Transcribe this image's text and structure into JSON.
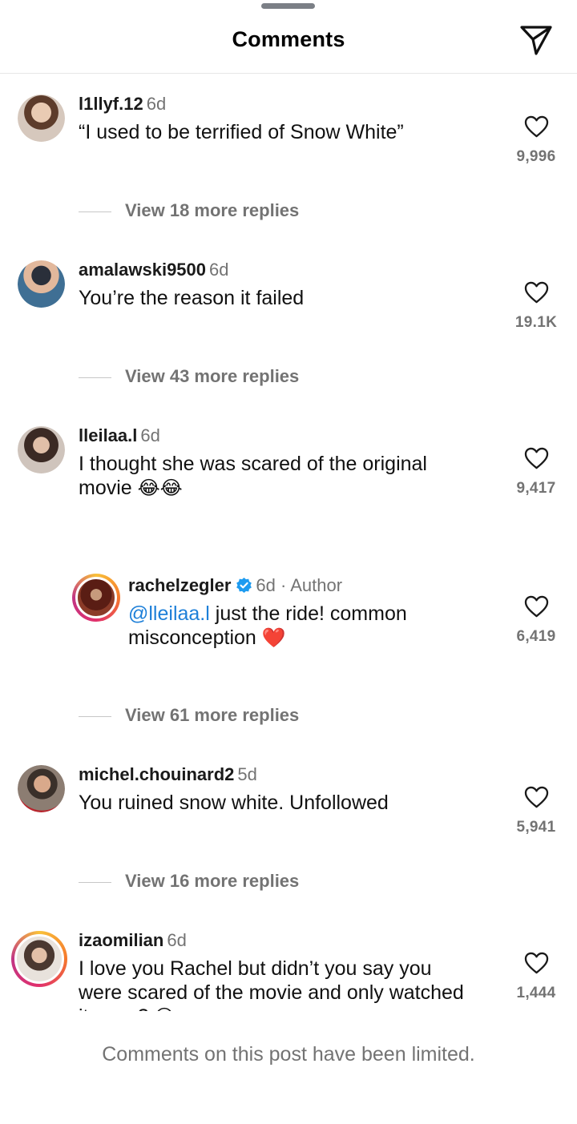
{
  "header": {
    "title": "Comments"
  },
  "comments": [
    {
      "username": "l1llyf.12",
      "time": "6d",
      "text": "“I used to be terrified of Snow White”",
      "likes": "9,996",
      "avatar_color": "#c9a78f",
      "replies_label": "View 18 more replies"
    },
    {
      "username": "amalawski9500",
      "time": "6d",
      "text": "You’re the reason it failed",
      "likes": "19.1K",
      "avatar_color": "#4a7fa8",
      "replies_label": "View 43 more replies"
    },
    {
      "username": "lleilaa.l",
      "time": "6d",
      "text": "I thought she was scared of the original movie",
      "emoji": "😂😂",
      "likes": "9,417",
      "avatar_color": "#8a7468"
    },
    {
      "username": "rachelzegler",
      "time": "6d",
      "author_label": "· Author",
      "mention": "@lleilaa.l",
      "text": " just the ride! common misconception",
      "emoji": "❤️",
      "likes": "6,419",
      "avatar_color": "#7a2a1e",
      "replies_label": "View 61 more replies"
    },
    {
      "username": "michel.chouinard2",
      "time": "5d",
      "text": "You ruined snow white. Unfollowed",
      "likes": "5,941",
      "avatar_color": "#6b5a4e",
      "replies_label": "View 16 more replies"
    },
    {
      "username": "izaomilian",
      "time": "6d",
      "text": "I love you Rachel but didn’t you say you were scared of the movie and only watched it once?",
      "emoji": "😅",
      "likes": "1,444",
      "avatar_color": "#b8a49a"
    }
  ],
  "footer": {
    "text": "Comments on this post have been limited."
  },
  "colors": {
    "accent": "#1d7fd8",
    "muted": "#737373",
    "verified": "#1d9bf0",
    "heart_red": "#e8262f"
  },
  "icons": {
    "share": "paper-plane-icon",
    "like": "heart-outline-icon",
    "verified": "verified-badge-icon"
  }
}
